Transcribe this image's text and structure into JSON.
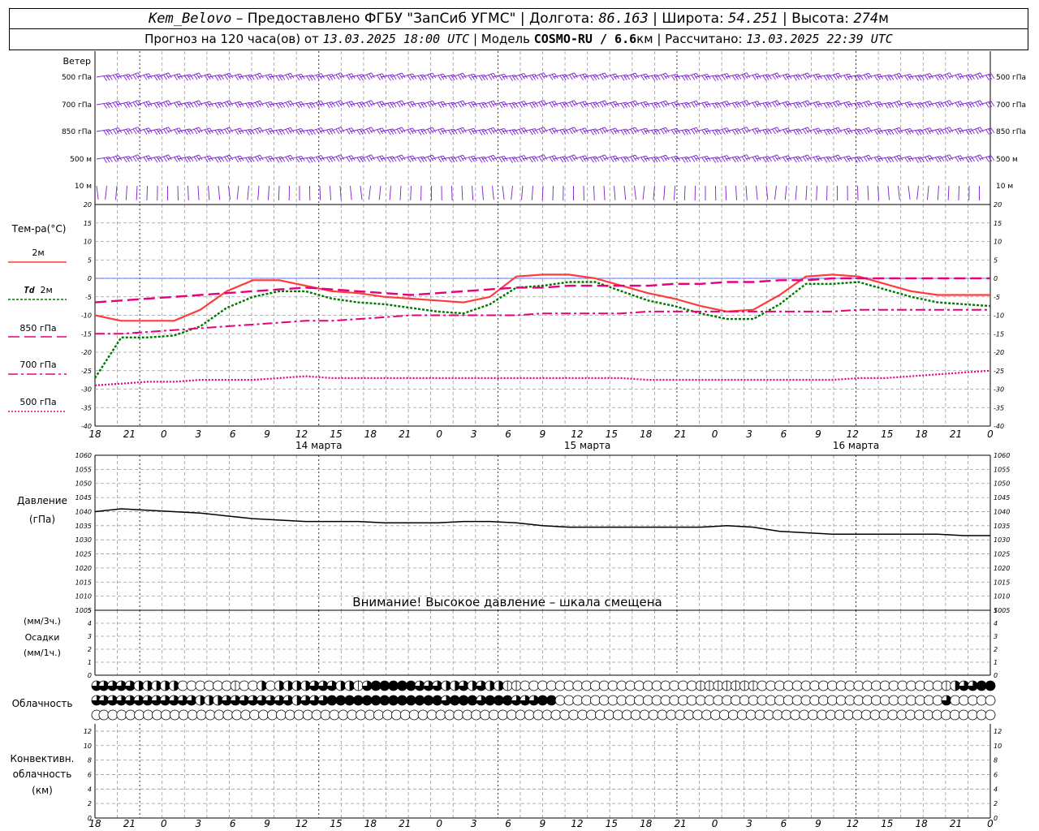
{
  "header": {
    "station": "Kem_Belovo",
    "provided": " – Предоставлено ФГБУ \"ЗапСиб УГМС\" |",
    "lon_label": " Долгота: ",
    "lon": "86.163",
    "lat_label": " | Широта: ",
    "lat": "54.251",
    "alt_label": " | Высота: ",
    "alt": "274",
    "alt_unit": "м",
    "forecast_label": "Прогноз на 120 часа(ов) от ",
    "run": "13.03.2025 18:00 UTC",
    "model_label": " | Модель ",
    "model": "COSMO-RU / 6.6",
    "model_unit": "км",
    "calc_label": " | Рассчитано: ",
    "calc": "13.03.2025 22:39 UTC"
  },
  "labels": {
    "wind": "Ветер",
    "temp": "Тем-ра(°C)",
    "t2m": "2м",
    "td": "Td",
    "td_level": "2м",
    "t850": "850 гПа",
    "t700": "700 гПа",
    "t500": "500 гПа",
    "pressure": "Давление",
    "pressure_unit": "(гПа)",
    "precip_unit3": "(мм/3ч.)",
    "precip": "Осадки",
    "precip_unit1": "(мм/1ч.)",
    "cloud": "Облачность",
    "conv1": "Конвективн.",
    "conv2": "облачность",
    "conv_unit": "(км)",
    "warning": "Внимание! Высокое давление – шкала смещена"
  },
  "wind_levels": [
    "500 гПа",
    "700 гПа",
    "850 гПа",
    "500 м",
    "10 м"
  ],
  "x_ticks": [
    "18",
    "21",
    "0",
    "3",
    "6",
    "9",
    "12",
    "15",
    "18",
    "21",
    "0",
    "3",
    "6",
    "9",
    "12",
    "15",
    "18",
    "21",
    "0",
    "3",
    "6",
    "9",
    "12",
    "15",
    "18",
    "21",
    "0"
  ],
  "day_labels": [
    "14 марта",
    "15 марта",
    "16 марта"
  ],
  "colors": {
    "t2m": "#ff3c3c",
    "td": "#007800",
    "t850": "#e6007e",
    "t700": "#e6007e",
    "t500": "#e6007e",
    "wind": "#7a1ed2",
    "zero_line": "#3050ff",
    "pressure": "#000000",
    "grid": "#999999"
  },
  "chart_data": [
    {
      "type": "line",
      "title": "Тем-ра(°C)",
      "x_hours": [
        0,
        3,
        6,
        9,
        12,
        15,
        18,
        21,
        24,
        27,
        30,
        33,
        36,
        39,
        42,
        45,
        48,
        51,
        54,
        57,
        60,
        63,
        66,
        69,
        72,
        75,
        78,
        81,
        84,
        87,
        90,
        93,
        96,
        99,
        102,
        105,
        108,
        111,
        114,
        117,
        120
      ],
      "ylim": [
        -40,
        20
      ],
      "y_ticks": [
        20,
        15,
        10,
        5,
        0,
        -5,
        -10,
        -15,
        -20,
        -25,
        -30,
        -35,
        -40
      ],
      "series": [
        {
          "name": "2м",
          "values": [
            -10,
            -11.5,
            -11.5,
            -11.5,
            -8.5,
            -3.5,
            -0.5,
            -0.5,
            -2,
            -3.5,
            -4,
            -5,
            -5.5,
            -6,
            -6.5,
            -5,
            0.5,
            1,
            1,
            0,
            -2,
            -4,
            -5.5,
            -7.5,
            -9,
            -8.5,
            -4.5,
            0.5,
            1,
            0.5,
            -1.5,
            -3.5,
            -4.5,
            -4.5,
            -4.5
          ]
        },
        {
          "name": "Td 2м",
          "values": [
            -27,
            -16,
            -16,
            -15.5,
            -13,
            -8,
            -5,
            -3.5,
            -3.5,
            -5.5,
            -6.5,
            -7,
            -8,
            -9,
            -9.5,
            -7,
            -2.5,
            -2,
            -1,
            -1,
            -3.5,
            -6,
            -7.5,
            -9.5,
            -11,
            -11,
            -7,
            -1.5,
            -1.5,
            -1,
            -3,
            -5,
            -6.5,
            -7,
            -7.5
          ]
        },
        {
          "name": "850 гПа",
          "values": [
            -6.5,
            -6,
            -5.5,
            -5,
            -4.5,
            -4,
            -3.5,
            -3,
            -2.5,
            -3,
            -3.5,
            -4,
            -4.5,
            -4,
            -3.5,
            -3,
            -2.5,
            -2.5,
            -2,
            -2,
            -2,
            -2,
            -1.5,
            -1.5,
            -1,
            -1,
            -0.5,
            -0.5,
            0,
            0,
            0,
            0,
            0,
            0,
            0
          ]
        },
        {
          "name": "700 гПа",
          "values": [
            -15,
            -15,
            -14.5,
            -14,
            -13.5,
            -13,
            -12.5,
            -12,
            -11.5,
            -11.5,
            -11,
            -10.5,
            -10,
            -10,
            -10,
            -10,
            -10,
            -9.5,
            -9.5,
            -9.5,
            -9.5,
            -9,
            -9,
            -9,
            -9,
            -9,
            -9,
            -9,
            -9,
            -8.5,
            -8.5,
            -8.5,
            -8.5,
            -8.5,
            -8.5
          ]
        },
        {
          "name": "500 гПа",
          "values": [
            -29,
            -28.5,
            -28,
            -28,
            -27.5,
            -27.5,
            -27.5,
            -27,
            -26.5,
            -27,
            -27,
            -27,
            -27,
            -27,
            -27,
            -27,
            -27,
            -27,
            -27,
            -27,
            -27,
            -27.5,
            -27.5,
            -27.5,
            -27.5,
            -27.5,
            -27.5,
            -27.5,
            -27.5,
            -27,
            -27,
            -26.5,
            -26,
            -25.5,
            -25
          ]
        }
      ]
    },
    {
      "type": "line",
      "title": "Давление",
      "ylabel": "(гПа)",
      "ylim": [
        1005,
        1060
      ],
      "y_ticks": [
        1060,
        1055,
        1050,
        1045,
        1040,
        1035,
        1030,
        1025,
        1020,
        1015,
        1010,
        1005
      ],
      "series": [
        {
          "name": "Давление",
          "values": [
            1040,
            1041,
            1040.5,
            1040,
            1039.5,
            1038.5,
            1037.5,
            1037,
            1036.5,
            1036.5,
            1036.5,
            1036,
            1036,
            1036,
            1036.5,
            1036.5,
            1036,
            1035,
            1034.5,
            1034.5,
            1034.5,
            1034.5,
            1034.5,
            1034.5,
            1035,
            1034.5,
            1033,
            1032.5,
            1032,
            1032,
            1032,
            1032,
            1032,
            1031.5,
            1031.5
          ]
        }
      ]
    },
    {
      "type": "bar",
      "title": "Осадки",
      "ylabel": "(мм/3ч.)",
      "ylim": [
        0,
        5
      ],
      "y_ticks": [
        5,
        4,
        3,
        2,
        1,
        0
      ],
      "series": []
    },
    {
      "type": "bar",
      "title": "Конвективн. облачность",
      "ylabel": "(км)",
      "ylim": [
        0,
        13
      ],
      "y_ticks": [
        12,
        10,
        8,
        6,
        4,
        2,
        0
      ],
      "series": []
    }
  ],
  "cloud_rows": [
    "3333322222000000100202222333221344444333223232211000000000000000000001111111000000000000000000000123344",
    "3333333333332223333333323334444444444444344434443334400000000000000000000000000000000000000000000300000",
    "000000000000000000000000000000000000000000000000000000000000000000000000000000000000000000000000000000"
  ]
}
